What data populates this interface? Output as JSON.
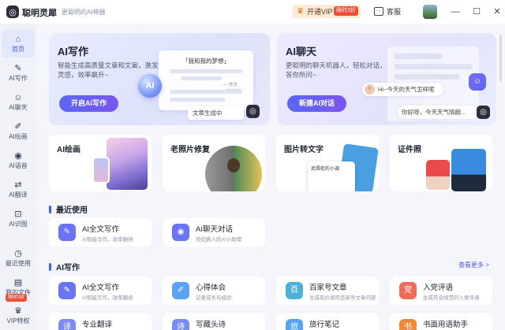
{
  "app": {
    "name": "聪明灵犀",
    "slogan": "更聪明的AI神器",
    "logo_glyph": "◎"
  },
  "topbar": {
    "vip_label": "开通VIP",
    "vip_promo": "限时3折",
    "service_label": "客服",
    "minimize": "—",
    "maximize": "☐",
    "close": "✕"
  },
  "sidebar": {
    "items": [
      {
        "label": "首页",
        "icon": "⌂"
      },
      {
        "label": "AI写作",
        "icon": "✎"
      },
      {
        "label": "AI聊天",
        "icon": "☺"
      },
      {
        "label": "AI绘画",
        "icon": "✐"
      },
      {
        "label": "AI语音",
        "icon": "◉"
      },
      {
        "label": "AI翻译",
        "icon": "⇄"
      },
      {
        "label": "AI识图",
        "icon": "⊡"
      },
      {
        "label": "最近使用",
        "icon": "◷"
      },
      {
        "label": "我的文件",
        "icon": "▤"
      },
      {
        "label": "VIP特权",
        "icon": "♛"
      }
    ],
    "free_badge": "限时3折"
  },
  "hero_write": {
    "title": "AI写作",
    "desc": "智能生成高质量文章和文案，激发灵感，效率飙升~",
    "button": "开启AI写作",
    "doc_title": "「我和我的梦想」",
    "doc_author": "— 作文（XXXX）",
    "ai_glyph": "AI",
    "gen_label": "文章生成中"
  },
  "hero_chat": {
    "title": "AI聊天",
    "desc": "更聪明的聊天机器人，轻松对话，答你所问~",
    "button": "新建AI对话",
    "msg_user": "Hi~今天的天气怎样呢",
    "msg_bot": "你好呀，今天天气晴朗..."
  },
  "feature_cards": [
    {
      "title": "AI绘画"
    },
    {
      "title": "老照片修复"
    },
    {
      "title": "图片转文字",
      "doc_title": "武昌街的小调"
    },
    {
      "title": "证件照"
    }
  ],
  "recent": {
    "heading": "最近使用",
    "items": [
      {
        "title": "AI全文写作",
        "sub": "AI智能写作，效率翻倍",
        "icon": "✎"
      },
      {
        "title": "AI聊天对话",
        "sub": "宛如真人的AI小助理",
        "icon": "◉"
      }
    ]
  },
  "writing": {
    "heading": "AI写作",
    "more": "查看更多 >",
    "items": [
      {
        "title": "AI全文写作",
        "sub": "AI智能写作，效率翻倍",
        "icon": "✎",
        "color": "#6b74f3"
      },
      {
        "title": "心得体会",
        "sub": "记录成长与经验",
        "icon": "✐",
        "color": "#5aa2f3"
      },
      {
        "title": "百家号文章",
        "sub": "生成有价值的百家号文章内容",
        "icon": "百",
        "color": "#4fb0d6"
      },
      {
        "title": "入党评语",
        "sub": "生成符合规范的入党评语",
        "icon": "党",
        "color": "#f06a5a"
      },
      {
        "title": "专业翻译",
        "sub": "",
        "icon": "译",
        "color": "#7a8bf5"
      },
      {
        "title": "写藏头诗",
        "sub": "",
        "icon": "诗",
        "color": "#7a8bf5"
      },
      {
        "title": "旅行笔记",
        "sub": "",
        "icon": "旅",
        "color": "#5aa2f3"
      },
      {
        "title": "书面用语助手",
        "sub": "",
        "icon": "书",
        "color": "#f08a3a"
      }
    ]
  }
}
